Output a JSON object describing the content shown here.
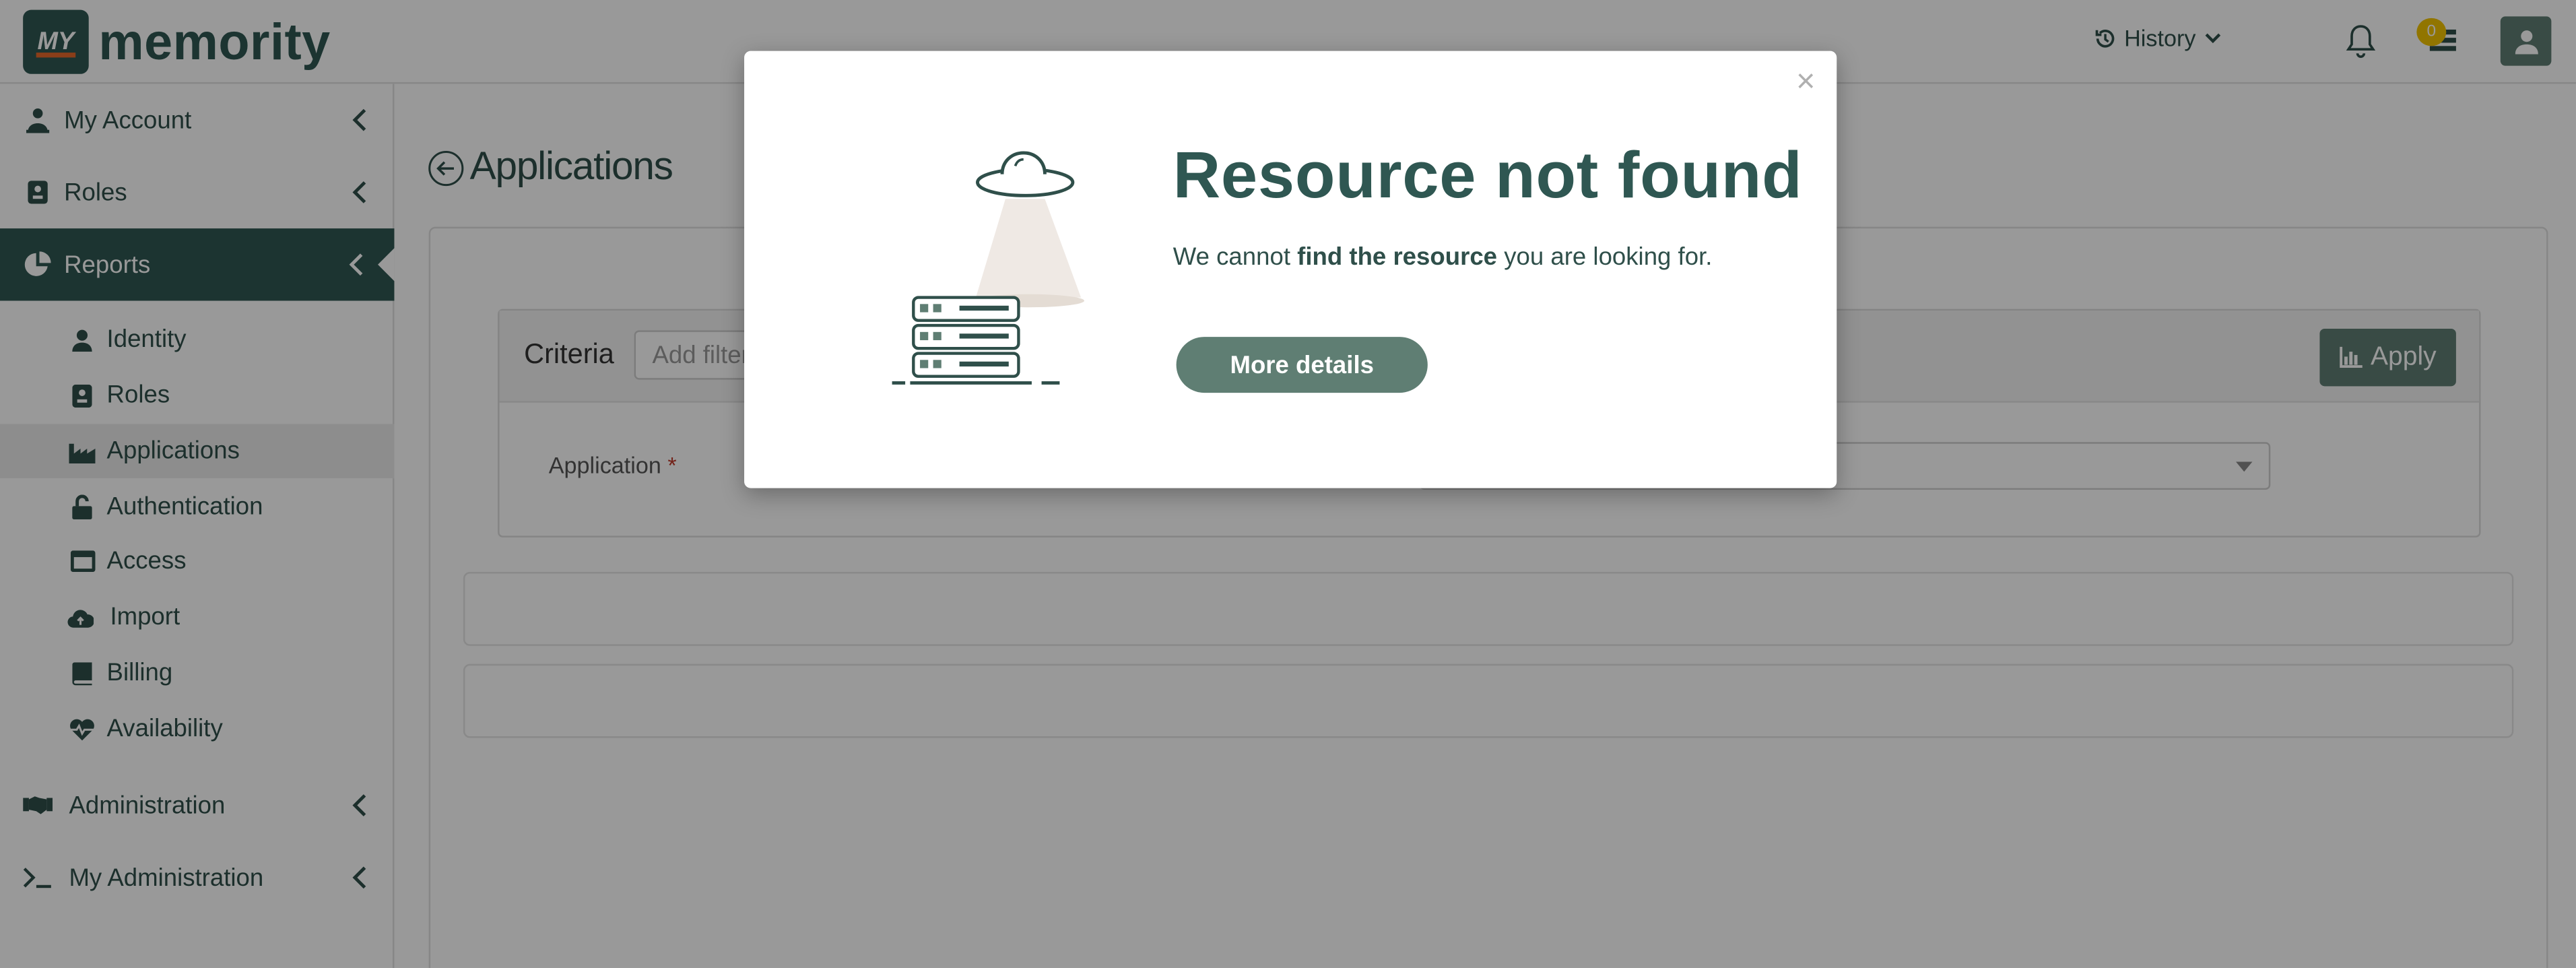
{
  "brand": {
    "logo_mark": "MY",
    "name": "memority",
    "accent": "#2f5752",
    "bar_color": "#e7682b"
  },
  "header": {
    "history_label": "History",
    "notification_count": "0"
  },
  "sidebar": {
    "items": [
      {
        "label": "My Account",
        "icon": "user-desk-icon"
      },
      {
        "label": "Roles",
        "icon": "id-badge-icon"
      },
      {
        "label": "Reports",
        "icon": "pie-chart-icon",
        "active": true
      },
      {
        "label": "Administration",
        "icon": "handshake-icon"
      },
      {
        "label": "My Administration",
        "icon": "terminal-icon"
      }
    ],
    "report_subitems": [
      {
        "label": "Identity",
        "icon": "user-icon"
      },
      {
        "label": "Roles",
        "icon": "id-badge-icon"
      },
      {
        "label": "Applications",
        "icon": "industry-icon",
        "selected": true
      },
      {
        "label": "Authentication",
        "icon": "unlock-icon"
      },
      {
        "label": "Access",
        "icon": "window-icon"
      },
      {
        "label": "Import",
        "icon": "cloud-upload-icon"
      },
      {
        "label": "Billing",
        "icon": "book-icon"
      },
      {
        "label": "Availability",
        "icon": "heartbeat-icon"
      }
    ]
  },
  "main": {
    "title": "Applications",
    "criteria": {
      "label": "Criteria",
      "filter_placeholder": "Add filter",
      "apply_label": "Apply",
      "application_label": "Application",
      "required_mark": "*"
    }
  },
  "modal": {
    "title": "Resource not found",
    "message_prefix": "We cannot ",
    "message_bold": "find the resource",
    "message_suffix": " you are looking for.",
    "button_label": "More details",
    "close_symbol": "×"
  }
}
